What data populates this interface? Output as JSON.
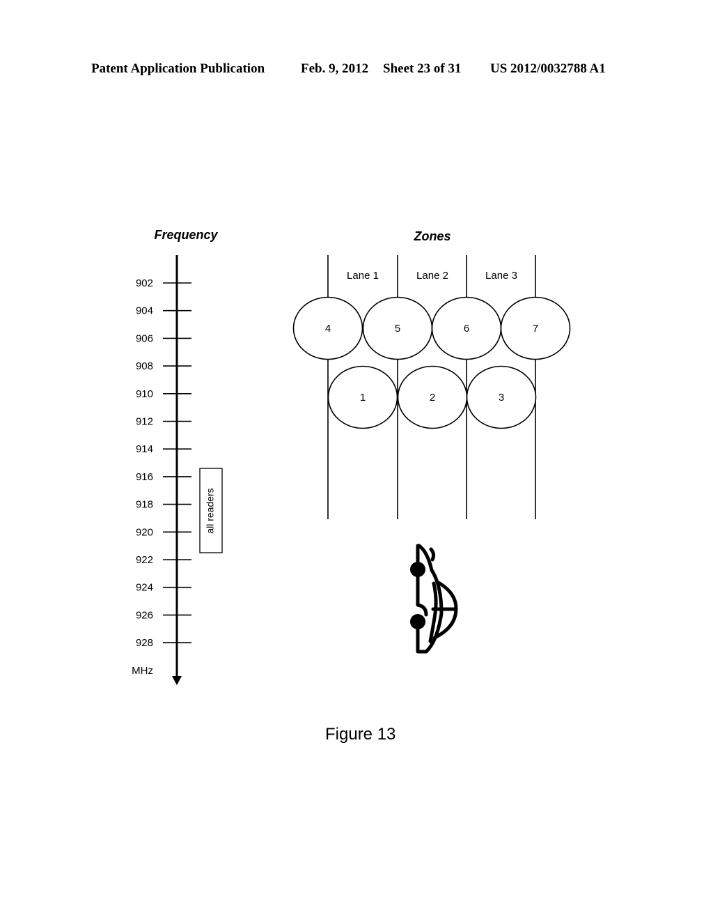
{
  "header": {
    "publication": "Patent Application Publication",
    "date": "Feb. 9, 2012",
    "sheet": "Sheet 23 of 31",
    "number": "US 2012/0032788 A1"
  },
  "frequency_axis": {
    "title": "Frequency",
    "unit": "MHz",
    "ticks": [
      "902",
      "904",
      "906",
      "908",
      "910",
      "912",
      "914",
      "916",
      "918",
      "920",
      "922",
      "924",
      "926",
      "928"
    ],
    "band": {
      "label": "all readers",
      "from_mhz": 915.5,
      "to_mhz": 922.5
    }
  },
  "zones": {
    "title": "Zones",
    "lanes": [
      "Lane 1",
      "Lane 2",
      "Lane 3"
    ],
    "upper_row": [
      "4",
      "5",
      "6",
      "7"
    ],
    "lower_row": [
      "1",
      "2",
      "3"
    ]
  },
  "vehicle": {
    "icon": "car-icon"
  },
  "caption": "Figure 13"
}
